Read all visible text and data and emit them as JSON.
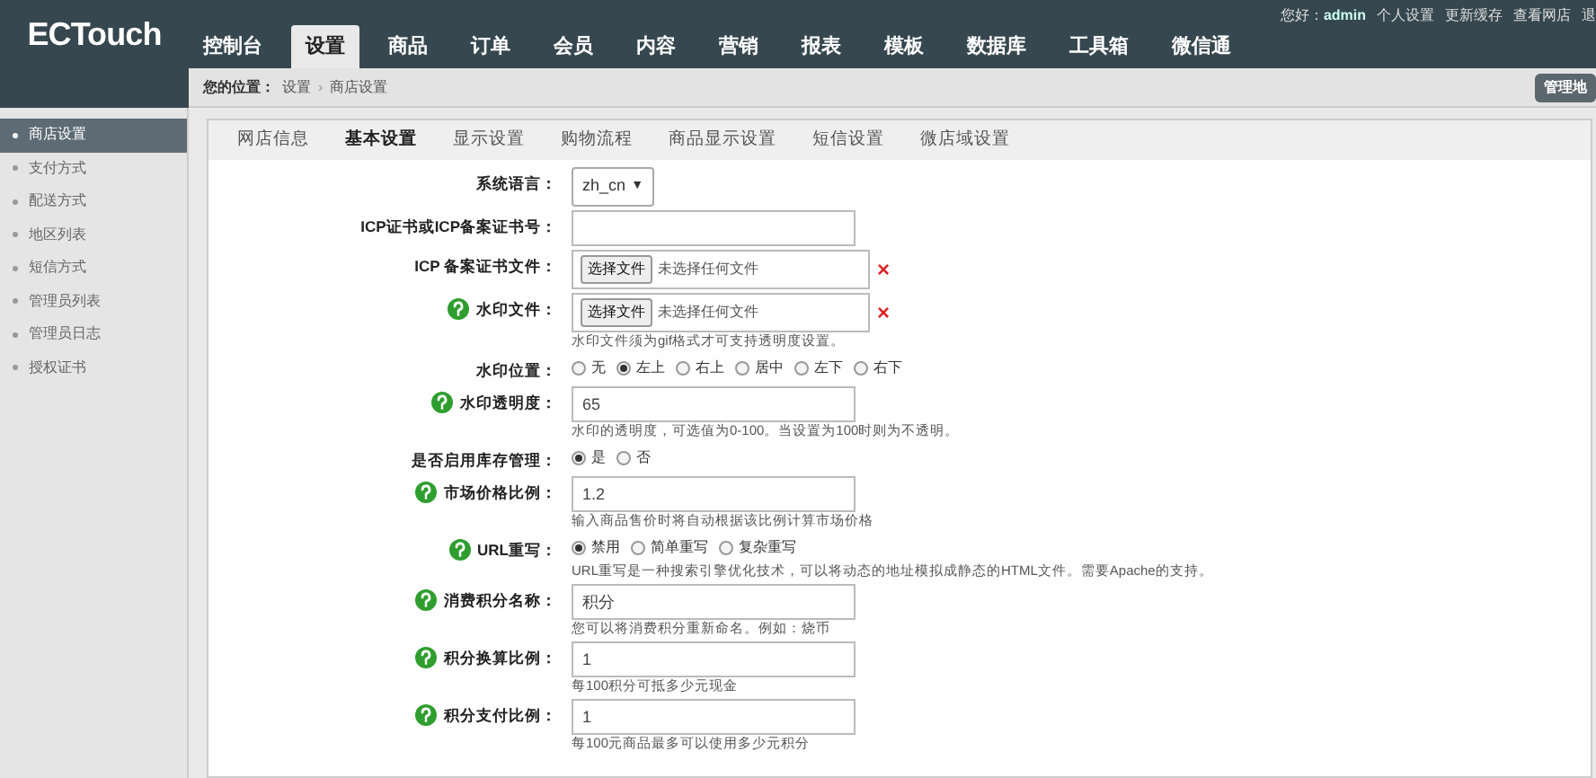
{
  "logo": "ECTouch",
  "nav": [
    {
      "label": "控制台",
      "selected": false
    },
    {
      "label": "设置",
      "selected": true
    },
    {
      "label": "商品",
      "selected": false
    },
    {
      "label": "订单",
      "selected": false
    },
    {
      "label": "会员",
      "selected": false
    },
    {
      "label": "内容",
      "selected": false
    },
    {
      "label": "营销",
      "selected": false
    },
    {
      "label": "报表",
      "selected": false
    },
    {
      "label": "模板",
      "selected": false
    },
    {
      "label": "数据库",
      "selected": false
    },
    {
      "label": "工具箱",
      "selected": false
    },
    {
      "label": "微信通",
      "selected": false
    }
  ],
  "user_bar": {
    "greeting": "您好：",
    "user": "admin",
    "links": [
      "个人设置",
      "更新缓存",
      "查看网店",
      "退"
    ]
  },
  "breadcrumb": {
    "label": "您的位置：",
    "items": [
      "设置",
      "商店设置"
    ],
    "separator": "›"
  },
  "map_button": "管理地",
  "sidebar": [
    {
      "label": "商店设置",
      "selected": true
    },
    {
      "label": "支付方式",
      "selected": false
    },
    {
      "label": "配送方式",
      "selected": false
    },
    {
      "label": "地区列表",
      "selected": false
    },
    {
      "label": "短信方式",
      "selected": false
    },
    {
      "label": "管理员列表",
      "selected": false
    },
    {
      "label": "管理员日志",
      "selected": false
    },
    {
      "label": "授权证书",
      "selected": false
    }
  ],
  "tabs": [
    {
      "label": "网店信息",
      "selected": false
    },
    {
      "label": "基本设置",
      "selected": true
    },
    {
      "label": "显示设置",
      "selected": false
    },
    {
      "label": "购物流程",
      "selected": false
    },
    {
      "label": "商品显示设置",
      "selected": false
    },
    {
      "label": "短信设置",
      "selected": false
    },
    {
      "label": "微店域设置",
      "selected": false
    }
  ],
  "form": [
    {
      "kind": "select",
      "label": "系统语言：",
      "help": false,
      "value": "zh_cn",
      "arrow": "▼"
    },
    {
      "kind": "text",
      "label": "ICP证书或ICP备案证书号：",
      "help": false
    },
    {
      "kind": "file",
      "label": "ICP 备案证书文件：",
      "help": false,
      "button": "选择文件",
      "value": "未选择任何文件",
      "remove": "×"
    },
    {
      "kind": "file",
      "label": "水印文件：",
      "help": true,
      "button": "选择文件",
      "value": "未选择任何文件",
      "remove": "×",
      "note": "水印文件须为gif格式才可支持透明度设置。"
    },
    {
      "kind": "radio",
      "label": "水印位置：",
      "help": false,
      "options": [
        {
          "label": "无",
          "selected": false
        },
        {
          "label": "左上",
          "selected": true
        },
        {
          "label": "右上",
          "selected": false
        },
        {
          "label": "居中",
          "selected": false
        },
        {
          "label": "左下",
          "selected": false
        },
        {
          "label": "右下",
          "selected": false
        }
      ]
    },
    {
      "kind": "text",
      "label": "水印透明度：",
      "help": true,
      "value": "65",
      "note": "水印的透明度，可选值为0-100。当设置为100时则为不透明。"
    },
    {
      "kind": "radio",
      "label": "是否启用库存管理：",
      "help": false,
      "options": [
        {
          "label": "是",
          "selected": true
        },
        {
          "label": "否",
          "selected": false
        }
      ]
    },
    {
      "kind": "text",
      "label": "市场价格比例：",
      "help": true,
      "value": "1.2",
      "note": "输入商品售价时将自动根据该比例计算市场价格"
    },
    {
      "kind": "radio",
      "label": "URL重写：",
      "help": true,
      "options": [
        {
          "label": "禁用",
          "selected": true
        },
        {
          "label": "简单重写",
          "selected": false
        },
        {
          "label": "复杂重写",
          "selected": false
        }
      ],
      "note": "URL重写是一种搜索引擎优化技术，可以将动态的地址模拟成静态的HTML文件。需要Apache的支持。"
    },
    {
      "kind": "text",
      "label": "消费积分名称：",
      "help": true,
      "value": "积分",
      "note": "您可以将消费积分重新命名。例如：烧币"
    },
    {
      "kind": "text",
      "label": "积分换算比例：",
      "help": true,
      "value": "1",
      "note": "每100积分可抵多少元现金"
    },
    {
      "kind": "text",
      "label": "积分支付比例：",
      "help": true,
      "value": "1",
      "note": "每100元商品最多可以使用多少元积分"
    }
  ]
}
